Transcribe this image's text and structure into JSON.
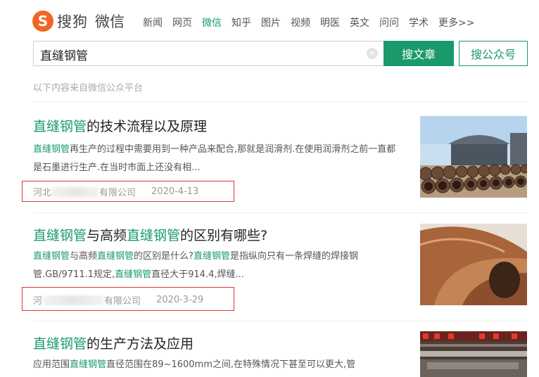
{
  "brand": {
    "mark": "S",
    "name": "搜狗",
    "product": "微信"
  },
  "nav": [
    "新闻",
    "网页",
    "微信",
    "知乎",
    "图片",
    "视频",
    "明医",
    "英文",
    "问问",
    "学术",
    "更多>>"
  ],
  "nav_active_index": 2,
  "search": {
    "value": "直缝钢管",
    "clear_icon": "×"
  },
  "buttons": {
    "search_article": "搜文章",
    "search_account": "搜公众号"
  },
  "source_note": "以下内容来自微信公众平台",
  "results": [
    {
      "title_parts": [
        {
          "t": "直缝钢管",
          "hl": true
        },
        {
          "t": "的技术流程以及原理",
          "hl": false
        }
      ],
      "desc_parts": [
        {
          "t": "直缝钢管",
          "hl": true
        },
        {
          "t": "再生产的过程中需要用到一种产品来配合,那就是润滑剂.在使用润滑剂之前一直都是石墨进行生产.在当时市面上还没有相...",
          "hl": false
        }
      ],
      "source_prefix": "河北",
      "source_suffix": "有限公司",
      "date": "2020-4-13"
    },
    {
      "title_parts": [
        {
          "t": "直缝钢管",
          "hl": true
        },
        {
          "t": "与高频",
          "hl": false
        },
        {
          "t": "直缝钢管",
          "hl": true
        },
        {
          "t": "的区别有哪些?",
          "hl": false
        }
      ],
      "desc_parts": [
        {
          "t": "直缝钢管",
          "hl": true
        },
        {
          "t": "与高频",
          "hl": false
        },
        {
          "t": "直缝钢管",
          "hl": true
        },
        {
          "t": "的区别是什么?",
          "hl": false
        },
        {
          "t": "直缝钢管",
          "hl": true
        },
        {
          "t": "是指纵向只有一条焊缝的焊接钢管.GB/9711.1规定,",
          "hl": false
        },
        {
          "t": "直缝钢管",
          "hl": true
        },
        {
          "t": "直径大于914.4,焊缝...",
          "hl": false
        }
      ],
      "source_prefix": "河",
      "source_suffix": "有限公司",
      "date": "2020-3-29"
    },
    {
      "title_parts": [
        {
          "t": "直缝钢管",
          "hl": true
        },
        {
          "t": "的生产方法及应用",
          "hl": false
        }
      ],
      "desc_parts": [
        {
          "t": "应用范围",
          "hl": false
        },
        {
          "t": "直缝钢管",
          "hl": true
        },
        {
          "t": "直径范围在89~1600mm之间,在特殊情况下甚至可以更大,管",
          "hl": false
        }
      ],
      "source_prefix": "",
      "source_suffix": "",
      "date": ""
    }
  ]
}
